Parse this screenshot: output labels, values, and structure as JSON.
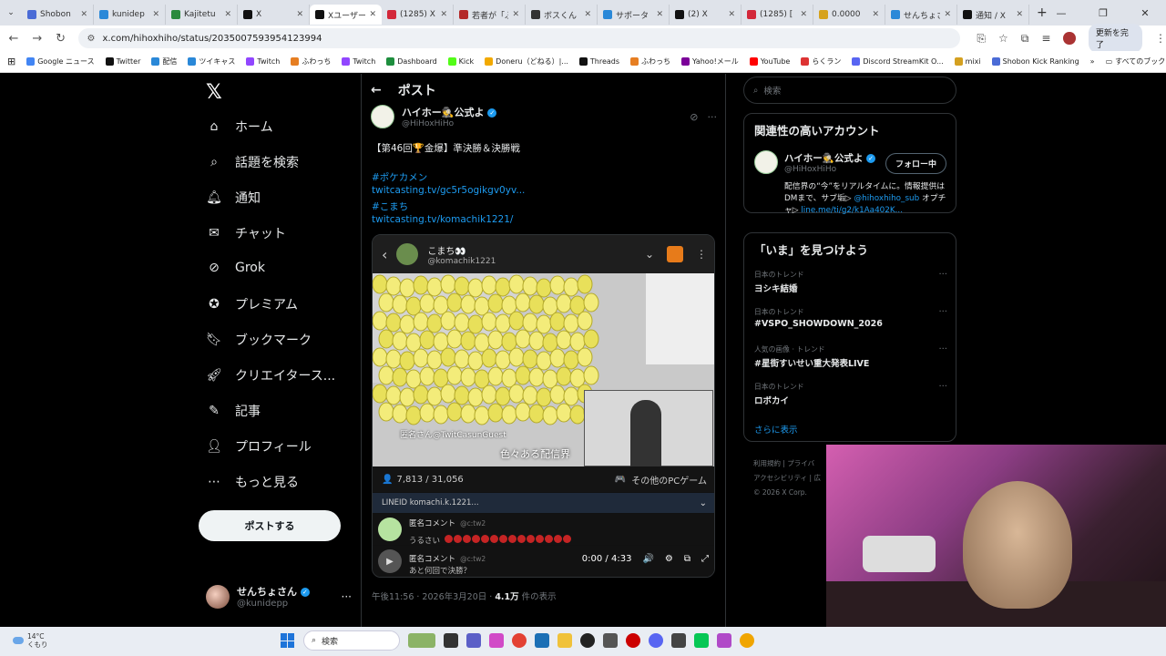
{
  "browser": {
    "tabs": [
      {
        "label": "Shobon",
        "color": "#4a6bd6"
      },
      {
        "label": "kunidep",
        "color": "#2a88d8"
      },
      {
        "label": "Kajitetu",
        "color": "#2b8a3e"
      },
      {
        "label": "X",
        "color": "#111111"
      },
      {
        "label": "Xユーザー",
        "color": "#111111",
        "active": true
      },
      {
        "label": "(1285) X",
        "color": "#d3283a"
      },
      {
        "label": "若者が「ふ",
        "color": "#b42a2a"
      },
      {
        "label": "ボスくん",
        "color": "#333333"
      },
      {
        "label": "サポータ",
        "color": "#2a88d8"
      },
      {
        "label": "(2) X",
        "color": "#111111"
      },
      {
        "label": "(1285) [",
        "color": "#d3283a"
      },
      {
        "label": "0.0000",
        "color": "#d6a21c"
      },
      {
        "label": "せんちょさ",
        "color": "#2a88d8"
      },
      {
        "label": "通知 / X",
        "color": "#111111"
      }
    ],
    "new_tab": "+",
    "win_controls": [
      "—",
      "❐",
      "✕"
    ],
    "url": "x.com/hihoxhiho/status/2035007593954123994",
    "update_label": "更新を完了",
    "bookmarks": [
      "Google ニュース",
      "Twitter",
      "配信",
      "ツイキャス",
      "Twitch",
      "ふわっち",
      "Twitch",
      "Dashboard",
      "Kick",
      "Doneru（どねる）|...",
      "Threads",
      "ふわっち",
      "Yahoo!メール",
      "YouTube",
      "らくラン",
      "Discord StreamKit O...",
      "mixi",
      "Shobon Kick Ranking"
    ],
    "bookmarks_more": "»",
    "all_bookmarks": "すべてのブックマーク"
  },
  "nav": {
    "items": [
      {
        "label": "ホーム",
        "icon": "home-icon"
      },
      {
        "label": "話題を検索",
        "icon": "search-icon"
      },
      {
        "label": "通知",
        "icon": "bell-icon"
      },
      {
        "label": "チャット",
        "icon": "mail-icon"
      },
      {
        "label": "Grok",
        "icon": "grok-icon"
      },
      {
        "label": "プレミアム",
        "icon": "premium-icon"
      },
      {
        "label": "ブックマーク",
        "icon": "bookmark-icon"
      },
      {
        "label": "クリエイタース...",
        "icon": "rocket-icon"
      },
      {
        "label": "記事",
        "icon": "article-icon"
      },
      {
        "label": "プロフィール",
        "icon": "profile-icon"
      },
      {
        "label": "もっと見る",
        "icon": "more-icon"
      }
    ],
    "post_button": "ポストする",
    "account": {
      "name": "せんちょさん",
      "handle": "@kunidepp"
    }
  },
  "post": {
    "header": "ポスト",
    "author_name": "ハイホー🕵公式よ",
    "author_handle": "@HiHoxHiHo",
    "text1": "【第46回🏆金爆】準決勝＆決勝戦",
    "hashtag1": "#ポケカメン",
    "link1": "twitcasting.tv/gc5r5ogikgv0yv...",
    "hashtag2": "#こまち",
    "link2": "twitcasting.tv/komachik1221/",
    "media": {
      "name": "こまち👀",
      "handle": "@komachik1221",
      "overlay_small": "匿名さん@TwitCasunGuest",
      "overlay_text": "色々ある配信界",
      "viewers": "7,813 / 31,056",
      "category": "その他のPCゲーム",
      "lineid": "LINEID komachi.k.1221...",
      "comments": [
        {
          "name": "匿名コメント",
          "handle": "@c:tw2",
          "text": "うるさい"
        },
        {
          "name": "匿名コメント",
          "handle": "@c:tw2",
          "text": "あと何回で決勝？"
        }
      ],
      "time": "0:00 / 4:33"
    },
    "meta_time": "午後11:56 · 2026年3月20日 · ",
    "meta_views": "4.1万",
    "meta_suffix": " 件の表示"
  },
  "right": {
    "search_placeholder": "検索",
    "related_title": "関連性の高いアカウント",
    "related": {
      "name": "ハイホー🕵公式よ",
      "handle": "@HiHoxHiHo",
      "follow": "フォロー中",
      "bio1": "配信界の“今”をリアルタイムに。情報提供はDMまで、サブ垢▷ ",
      "bio_link1": "@hihoxhiho_sub",
      "bio2": " オプチャ▷ ",
      "bio_link2": "line.me/ti/g2/k1Aa402K..."
    },
    "trends_title": "「いま」を見つけよう",
    "trends": [
      {
        "cat": "日本のトレンド",
        "title": "ヨシキ結婚"
      },
      {
        "cat": "日本のトレンド",
        "title": "#VSPO_SHOWDOWN_2026"
      },
      {
        "cat": "人気の画像 · トレンド",
        "title": "#星街すいせい重大発表LIVE"
      },
      {
        "cat": "日本のトレンド",
        "title": "ロボカイ"
      }
    ],
    "show_more": "さらに表示",
    "footer1": "利用規約 | プライバ",
    "footer2": "アクセシビリティ | 広",
    "footer3": "© 2026 X Corp."
  },
  "taskbar": {
    "temp": "14°C",
    "weather": "くもり",
    "search": "検索"
  }
}
